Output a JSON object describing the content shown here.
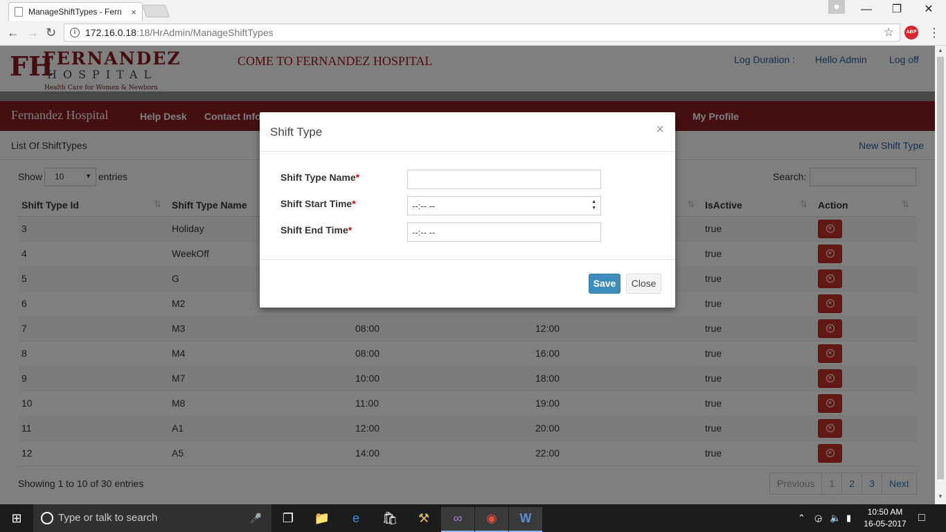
{
  "browser": {
    "tab_title": "ManageShiftTypes - Fern",
    "tab_close": "×",
    "url_host": "172.16.0.18",
    "url_path": ":18/HrAdmin/ManageShiftTypes",
    "abp_label": "ABP"
  },
  "header": {
    "logo_text": "FERNANDEZ",
    "logo_sub": "HOSPITAL",
    "logo_tagline": "Health Care for Women & Newborn",
    "welcome": "COME TO FERNANDEZ HOSPITAL",
    "log_duration": "Log Duration :",
    "hello": "Hello Admin",
    "logoff": "Log off"
  },
  "nav": {
    "brand": "Fernandez Hospital",
    "items": [
      "Help Desk",
      "Contact Info",
      "My Profile"
    ]
  },
  "list": {
    "title": "List Of ShiftTypes",
    "new_link": "New Shift Type",
    "show": "Show",
    "page_length": "10",
    "entries": "entries",
    "search": "Search:",
    "columns": [
      "Shift Type Id",
      "Shift Type Name",
      "",
      "",
      "IsActive",
      "Action"
    ],
    "rows": [
      {
        "id": "3",
        "name": "Holiday",
        "start": "",
        "end": "",
        "active": "true"
      },
      {
        "id": "4",
        "name": "WeekOff",
        "start": "",
        "end": "",
        "active": "true"
      },
      {
        "id": "5",
        "name": "G",
        "start": "",
        "end": "",
        "active": "true"
      },
      {
        "id": "6",
        "name": "M2",
        "start": "",
        "end": "",
        "active": "true"
      },
      {
        "id": "7",
        "name": "M3",
        "start": "08:00",
        "end": "12:00",
        "active": "true"
      },
      {
        "id": "8",
        "name": "M4",
        "start": "08:00",
        "end": "16:00",
        "active": "true"
      },
      {
        "id": "9",
        "name": "M7",
        "start": "10:00",
        "end": "18:00",
        "active": "true"
      },
      {
        "id": "10",
        "name": "M8",
        "start": "11:00",
        "end": "19:00",
        "active": "true"
      },
      {
        "id": "11",
        "name": "A1",
        "start": "12:00",
        "end": "20:00",
        "active": "true"
      },
      {
        "id": "12",
        "name": "A5",
        "start": "14:00",
        "end": "22:00",
        "active": "true"
      }
    ],
    "info": "Showing 1 to 10 of 30 entries",
    "pager": [
      "Previous",
      "1",
      "2",
      "3",
      "Next"
    ]
  },
  "modal": {
    "title": "Shift Type",
    "close_x": "×",
    "name_label": "Shift Type Name",
    "start_label": "Shift Start Time",
    "end_label": "Shift End Time",
    "required_mark": "*",
    "name_value": "",
    "start_value": "--:-- --",
    "end_value": "--:-- --",
    "save": "Save",
    "close": "Close"
  },
  "taskbar": {
    "search_placeholder": "Type or talk to search",
    "time": "10:50 AM",
    "date": "16-05-2017"
  },
  "colors": {
    "brand_red": "#8b1f22",
    "link_blue": "#2c5c9e",
    "save_blue": "#3c8dbc",
    "danger": "#c9302c"
  }
}
